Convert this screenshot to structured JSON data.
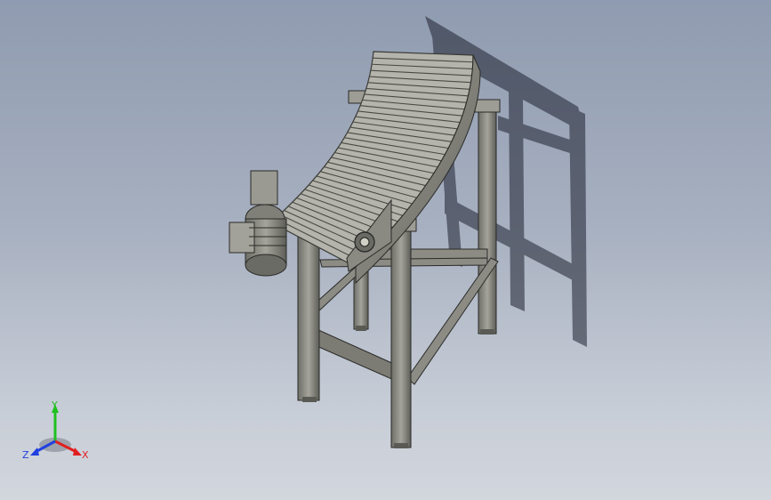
{
  "viewport": {
    "background_top": "#8f9bb0",
    "background_bottom": "#d2d6dd",
    "model_color": "#8b8b84",
    "shadow_color": "#1e2230"
  },
  "triad": {
    "x_label": "X",
    "y_label": "Y",
    "z_label": "Z",
    "x_color": "#e02020",
    "y_color": "#20c020",
    "z_color": "#2040e0"
  }
}
